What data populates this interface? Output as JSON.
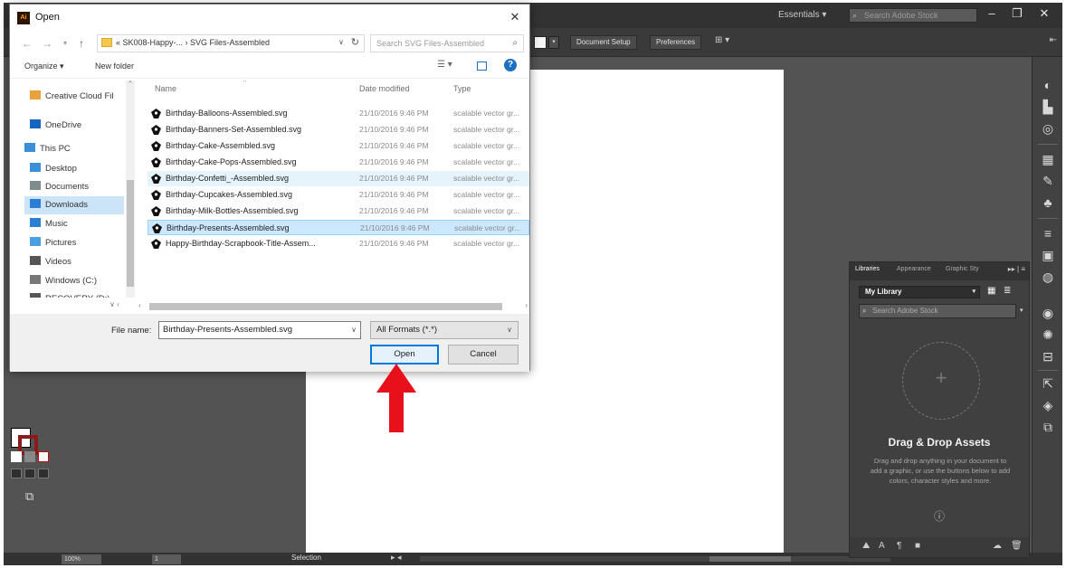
{
  "illustrator": {
    "workspace": "Essentials",
    "stock_search_placeholder": "Search Adobe Stock",
    "control_bar": {
      "document_setup": "Document Setup",
      "preferences": "Preferences"
    },
    "status_bar": {
      "zoom": "100%",
      "page": "1",
      "current_tool": "Selection"
    }
  },
  "libraries_panel": {
    "tabs": [
      "Libraries",
      "Appearance",
      "Graphic Sty"
    ],
    "library_name": "My Library",
    "search_placeholder": "Search Adobe Stock",
    "drop_title": "Drag & Drop Assets",
    "drop_description": "Drag and drop anything in your document to add a graphic, or use the buttons below to add colors, character styles and more.",
    "help_icon": "?"
  },
  "dialog": {
    "title": "Open",
    "breadcrumb": "« SK008-Happy-... › SVG Files-Assembled",
    "search_placeholder": "Search SVG Files-Assembled",
    "organize_label": "Organize ▾",
    "new_folder_label": "New folder",
    "nav_items": [
      {
        "label": "Creative Cloud Fil",
        "icon": "creative-cloud-icon",
        "color": "#e9a23b"
      },
      {
        "label": "OneDrive",
        "icon": "onedrive-icon",
        "color": "#1565c0"
      },
      {
        "label": "This PC",
        "icon": "this-pc-icon",
        "color": "#3a8fd6"
      },
      {
        "label": "Desktop",
        "icon": "desktop-icon",
        "color": "#3a8fd6"
      },
      {
        "label": "Documents",
        "icon": "documents-icon",
        "color": "#7f8c8d"
      },
      {
        "label": "Downloads",
        "icon": "downloads-icon",
        "color": "#2a7fd4"
      },
      {
        "label": "Music",
        "icon": "music-icon",
        "color": "#2a7fd4"
      },
      {
        "label": "Pictures",
        "icon": "pictures-icon",
        "color": "#4aa0e0"
      },
      {
        "label": "Videos",
        "icon": "videos-icon",
        "color": "#555555"
      },
      {
        "label": "Windows (C:)",
        "icon": "drive-icon",
        "color": "#777777"
      },
      {
        "label": "RECOVERY (D:)",
        "icon": "drive-icon",
        "color": "#555555"
      }
    ],
    "columns": {
      "name": "Name",
      "date": "Date modified",
      "type": "Type"
    },
    "files": [
      {
        "name": "Birthday-Balloons-Assembled.svg",
        "date": "21/10/2016 9:46 PM",
        "type": "scalable vector gr...",
        "state": ""
      },
      {
        "name": "Birthday-Banners-Set-Assembled.svg",
        "date": "21/10/2016 9:46 PM",
        "type": "scalable vector gr...",
        "state": ""
      },
      {
        "name": "Birthday-Cake-Assembled.svg",
        "date": "21/10/2016 9:46 PM",
        "type": "scalable vector gr...",
        "state": ""
      },
      {
        "name": "Birthday-Cake-Pops-Assembled.svg",
        "date": "21/10/2016 9:46 PM",
        "type": "scalable vector gr...",
        "state": ""
      },
      {
        "name": "Birthday-Confetti_-Assembled.svg",
        "date": "21/10/2016 9:46 PM",
        "type": "scalable vector gr...",
        "state": "hover"
      },
      {
        "name": "Birthday-Cupcakes-Assembled.svg",
        "date": "21/10/2016 9:46 PM",
        "type": "scalable vector gr...",
        "state": ""
      },
      {
        "name": "Birthday-Milk-Bottles-Assembled.svg",
        "date": "21/10/2016 9:46 PM",
        "type": "scalable vector gr...",
        "state": ""
      },
      {
        "name": "Birthday-Presents-Assembled.svg",
        "date": "21/10/2016 9:46 PM",
        "type": "scalable vector gr...",
        "state": "selected"
      },
      {
        "name": "Happy-Birthday-Scrapbook-Title-Assem...",
        "date": "21/10/2016 9:46 PM",
        "type": "scalable vector gr...",
        "state": ""
      }
    ],
    "file_name_label": "File name:",
    "file_name_value": "Birthday-Presents-Assembled.svg",
    "file_type_filter": "All Formats (*.*)",
    "open_label": "Open",
    "cancel_label": "Cancel"
  },
  "colors": {
    "accent": "#0078d7",
    "selection": "#cce8ff",
    "arrow": "#e8101a",
    "app_bg": "#535353"
  }
}
